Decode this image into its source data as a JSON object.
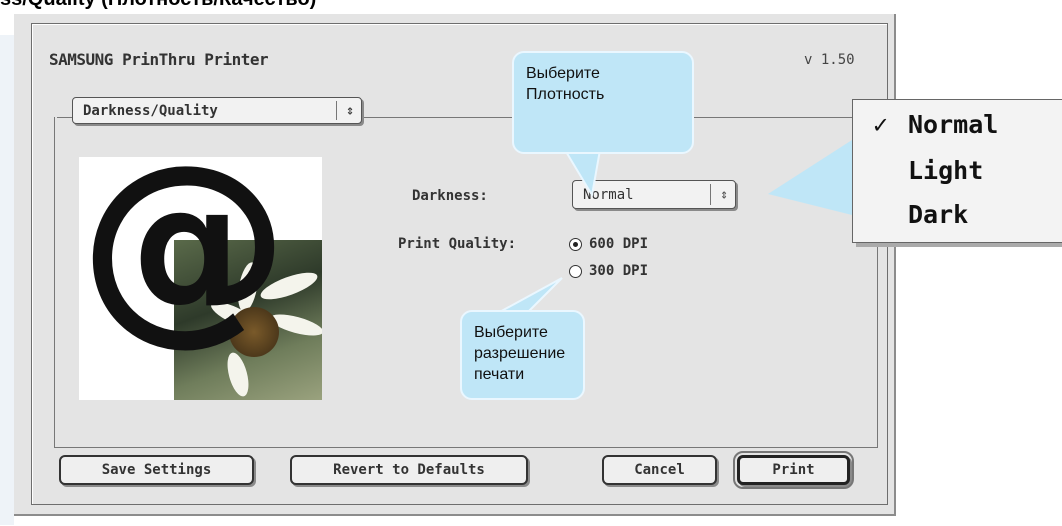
{
  "caption": "ss/Quality (Плотность/Качество)",
  "dialog": {
    "title": "SAMSUNG PrinThru Printer",
    "version": "v 1.50",
    "panel_selector": "Darkness/Quality",
    "darkness_label": "Darkness:",
    "darkness_value": "Normal",
    "print_quality_label": "Print Quality:",
    "quality_options": [
      {
        "label": "600 DPI",
        "selected": true
      },
      {
        "label": "300 DPI",
        "selected": false
      }
    ],
    "buttons": {
      "save": "Save Settings",
      "revert": "Revert to Defaults",
      "cancel": "Cancel",
      "print": "Print"
    },
    "preview_glyph": "@"
  },
  "callouts": {
    "density": "Выберите Плотность",
    "resolution": "Выберите разрешение печати"
  },
  "darkness_menu": {
    "checkmark": "✓",
    "items": [
      "Normal",
      "Light",
      "Dark"
    ],
    "selected": "Normal"
  },
  "colors": {
    "callout_fill": "#bfe6f7",
    "dialog_bg": "#e4e4e4"
  }
}
